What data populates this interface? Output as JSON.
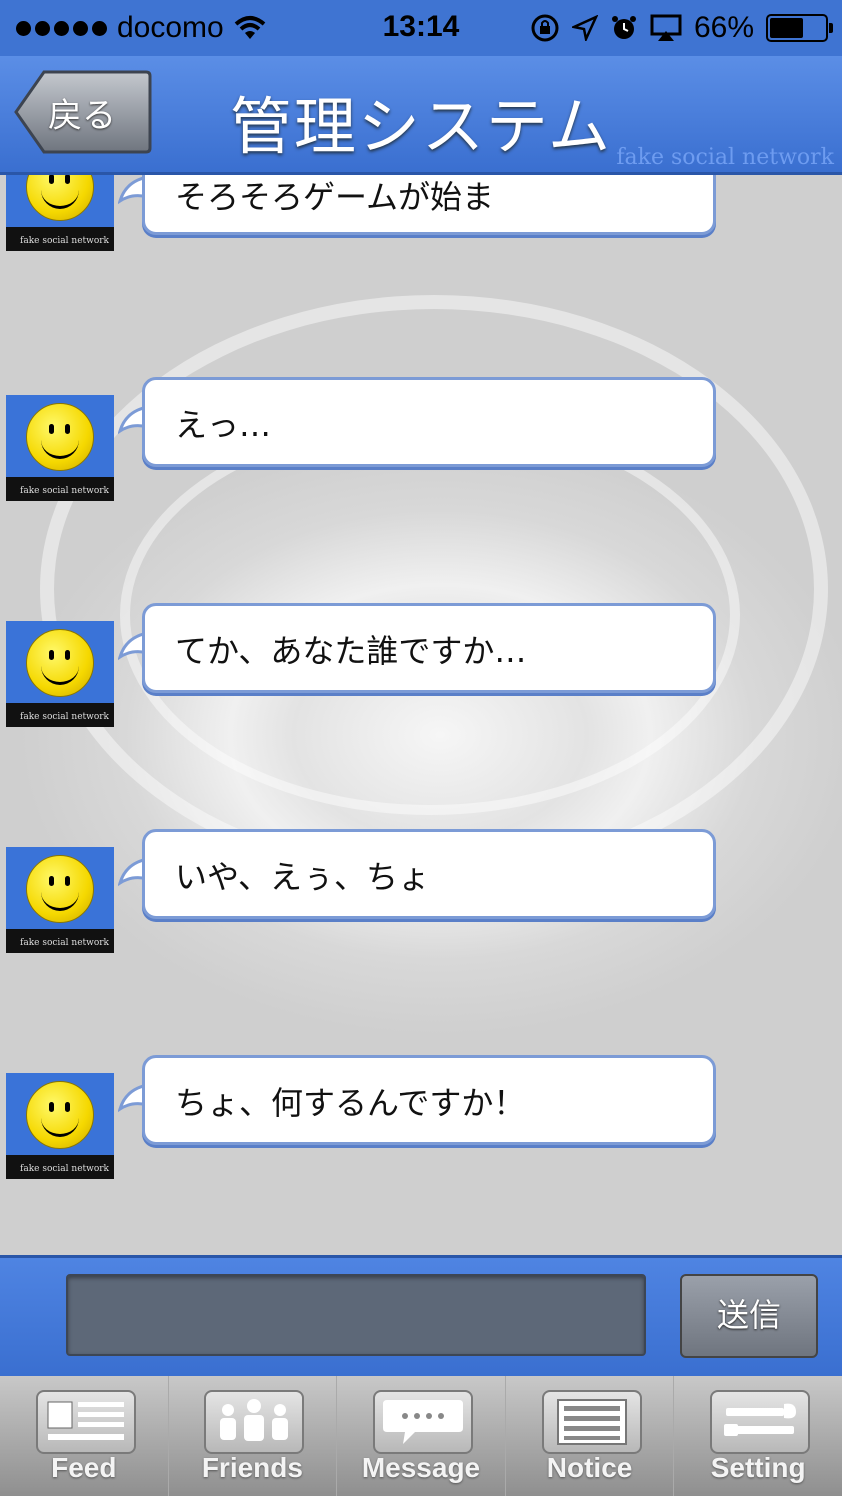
{
  "status_bar": {
    "carrier": "docomo",
    "time": "13:14",
    "battery_percent": "66%",
    "battery_level": 0.66,
    "icons": [
      "signal-dots-icon",
      "wifi-icon",
      "orientation-lock-icon",
      "location-icon",
      "alarm-icon",
      "airplay-icon",
      "battery-icon"
    ]
  },
  "nav": {
    "back_label": "戻る",
    "title": "管理システム",
    "watermark": "fake social network"
  },
  "messages": [
    {
      "text": "そろそろゲームが始ま",
      "avatar_caption": "fake social network"
    },
    {
      "text": "えっ…",
      "avatar_caption": "fake social network"
    },
    {
      "text": "てか、あなた誰ですか…",
      "avatar_caption": "fake social network"
    },
    {
      "text": "いや、えぅ、ちょ",
      "avatar_caption": "fake social network"
    },
    {
      "text": "ちょ、何するんですか！",
      "avatar_caption": "fake social network"
    }
  ],
  "composer": {
    "input_value": "",
    "send_label": "送信"
  },
  "tabs": [
    {
      "label": "Feed",
      "icon": "feed-icon"
    },
    {
      "label": "Friends",
      "icon": "friends-icon"
    },
    {
      "label": "Message",
      "icon": "message-icon"
    },
    {
      "label": "Notice",
      "icon": "notice-icon"
    },
    {
      "label": "Setting",
      "icon": "setting-icon"
    }
  ],
  "colors": {
    "accent_blue": "#3f74d2",
    "bubble_border": "#7c9bd6",
    "smiley_yellow": "#f5d800"
  }
}
